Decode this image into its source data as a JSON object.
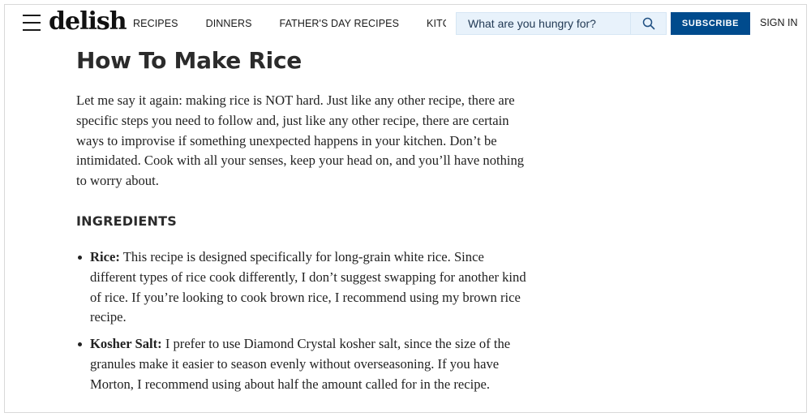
{
  "header": {
    "logo": "delish",
    "nav": [
      "RECIPES",
      "DINNERS",
      "FATHER'S DAY RECIPES",
      "KITCHEN TIPS"
    ],
    "search_placeholder": "What are you hungry for?",
    "subscribe_label": "SUBSCRIBE",
    "signin_label": "SIGN IN"
  },
  "article": {
    "title": "How To Make Rice",
    "intro": "Let me say it again: making rice is NOT hard. Just like any other recipe, there are specific steps you need to follow and, just like any other recipe, there are certain ways to improvise if something unexpected happens in your kitchen. Don’t be intimidated. Cook with all your senses, keep your head on, and you’ll have nothing to worry about.",
    "ingredients_heading": "INGREDIENTS",
    "ingredients": [
      {
        "term": "Rice:",
        "text": " This recipe is designed specifically for long-grain white rice. Since different types of rice cook differently, I don’t suggest swapping for another kind of rice. If you’re looking to cook brown rice, I recommend using my brown rice recipe."
      },
      {
        "term": "Kosher Salt:",
        "text": " I prefer to use Diamond Crystal kosher salt, since the size of the granules make it easier to season evenly without overseasoning. If you have Morton, I recommend using about half the amount called for in the recipe."
      }
    ]
  },
  "colors": {
    "subscribe_bg": "#004b8d",
    "search_bg": "#e8f2fb"
  }
}
